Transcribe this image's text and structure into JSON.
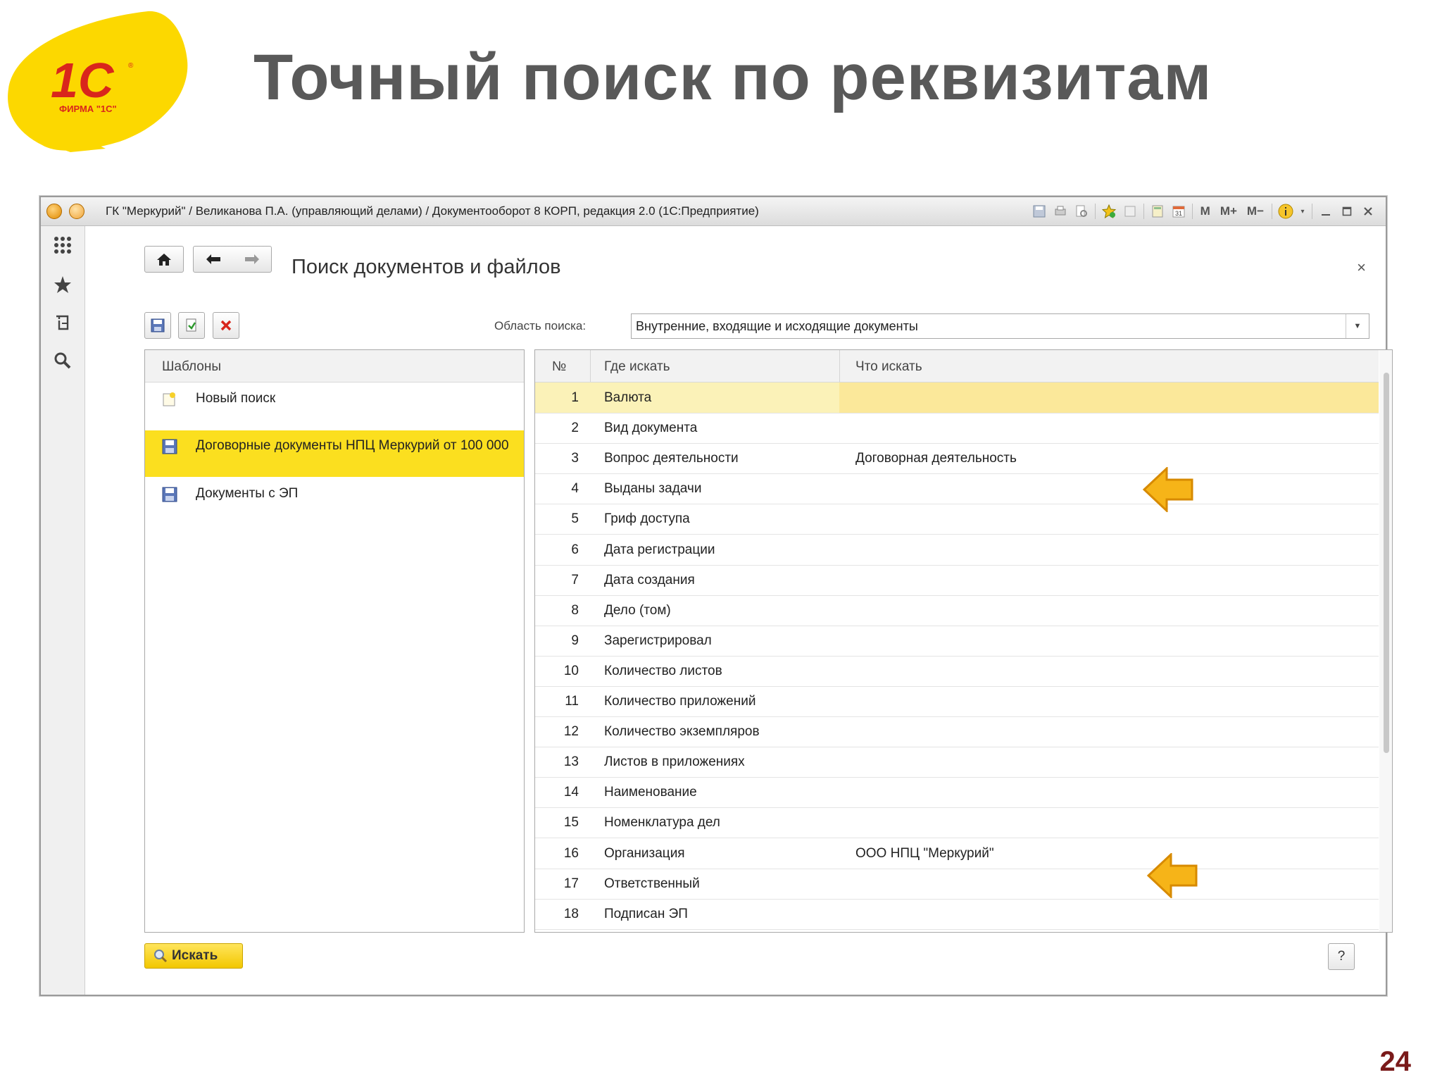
{
  "slide": {
    "title": "Точный поиск по реквизитам",
    "page_number": "24",
    "logo_text": "ФИРМА \"1С\""
  },
  "window": {
    "title": "ГК \"Меркурий\" / Великанова П.А. (управляющий делами) / Документооборот 8 КОРП, редакция 2.0  (1С:Предприятие)",
    "toolbar_icons": [
      "save-icon",
      "print-icon",
      "preview-icon",
      "favorites-icon",
      "history-icon",
      "calculator-icon",
      "calendar-icon",
      "memory-m",
      "memory-plus",
      "memory-minus",
      "info-icon",
      "minimize-icon",
      "maximize-icon",
      "close-icon"
    ],
    "memory_labels": [
      "M",
      "M+",
      "M−"
    ]
  },
  "sidebar": {
    "icons": [
      "apps-grid-icon",
      "star-icon",
      "history-icon",
      "search-icon"
    ]
  },
  "form": {
    "title": "Поиск документов и файлов",
    "search_area_label": "Область поиска:",
    "search_area_value": "Внутренние, входящие и исходящие документы",
    "templates_header": "Шаблоны",
    "templates": [
      {
        "label": "Новый поиск",
        "icon": "new-document-icon",
        "selected": false
      },
      {
        "label": "Договорные документы НПЦ Меркурий от 100 000",
        "icon": "floppy-icon",
        "selected": true
      },
      {
        "label": "Документы с ЭП",
        "icon": "floppy-icon",
        "selected": false
      }
    ],
    "grid_headers": {
      "num": "№",
      "where": "Где искать",
      "what": "Что искать"
    },
    "rows": [
      {
        "n": "1",
        "where": "Валюта",
        "what": ""
      },
      {
        "n": "2",
        "where": "Вид документа",
        "what": ""
      },
      {
        "n": "3",
        "where": "Вопрос деятельности",
        "what": "Договорная деятельность"
      },
      {
        "n": "4",
        "where": "Выданы задачи",
        "what": ""
      },
      {
        "n": "5",
        "where": "Гриф доступа",
        "what": ""
      },
      {
        "n": "6",
        "where": "Дата регистрации",
        "what": ""
      },
      {
        "n": "7",
        "where": "Дата создания",
        "what": ""
      },
      {
        "n": "8",
        "where": "Дело (том)",
        "what": ""
      },
      {
        "n": "9",
        "where": "Зарегистрировал",
        "what": ""
      },
      {
        "n": "10",
        "where": "Количество листов",
        "what": ""
      },
      {
        "n": "11",
        "where": "Количество приложений",
        "what": ""
      },
      {
        "n": "12",
        "where": "Количество экземпляров",
        "what": ""
      },
      {
        "n": "13",
        "where": "Листов в приложениях",
        "what": ""
      },
      {
        "n": "14",
        "where": "Наименование",
        "what": ""
      },
      {
        "n": "15",
        "where": "Номенклатура дел",
        "what": ""
      },
      {
        "n": "16",
        "where": "Организация",
        "what": "ООО НПЦ \"Меркурий\""
      },
      {
        "n": "17",
        "where": "Ответственный",
        "what": ""
      },
      {
        "n": "18",
        "where": "Подписан ЭП",
        "what": ""
      }
    ],
    "search_button": "Искать",
    "help_button": "?",
    "close_symbol": "×"
  },
  "colors": {
    "selected_row": "#fbdf1f",
    "accent_arrow": "#f6b418"
  }
}
